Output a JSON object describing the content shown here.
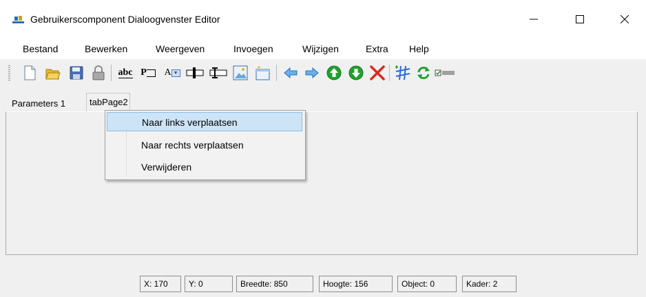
{
  "window": {
    "title": "Gebruikerscomponent Dialoogvenster Editor",
    "minimize_glyph": "—",
    "maximize_glyph": "☐",
    "close_glyph": "✕"
  },
  "menu": [
    "Bestand",
    "Bewerken",
    "Weergeven",
    "Invoegen",
    "Wijzigen",
    "Extra",
    "Help"
  ],
  "toolbar": {
    "icons": [
      "new-document-icon",
      "open-folder-icon",
      "save-icon",
      "lock-icon",
      "label-abc-icon",
      "textbox-p-icon",
      "dropdown-a-icon",
      "slider-icon",
      "textbox-i-icon",
      "image-icon",
      "panel-icon",
      "arrow-left-icon",
      "arrow-right-icon",
      "arrow-up-icon",
      "arrow-down-icon",
      "delete-icon",
      "grid-icon",
      "refresh-icon",
      "checkbox-icon"
    ],
    "labels": {
      "abc": "abc",
      "p": "P",
      "a": "A"
    }
  },
  "tabs": [
    "Parameters 1",
    "tabPage2"
  ],
  "context_menu": {
    "items": [
      "Naar links verplaatsen",
      "Naar rechts verplaatsen",
      "Verwijderen"
    ],
    "highlighted": 0
  },
  "status": {
    "x": "X: 170",
    "y": "Y: 0",
    "breedte": "Breedte: 850",
    "hoogte": "Hoogte: 156",
    "object": "Object: 0",
    "kader": "Kader: 2"
  },
  "colors": {
    "highlight": "#cde4f7",
    "highlight_border": "#88bde8",
    "arrow_blue": "#3a8fd8",
    "green": "#1e9a2e",
    "red": "#e0281c"
  }
}
